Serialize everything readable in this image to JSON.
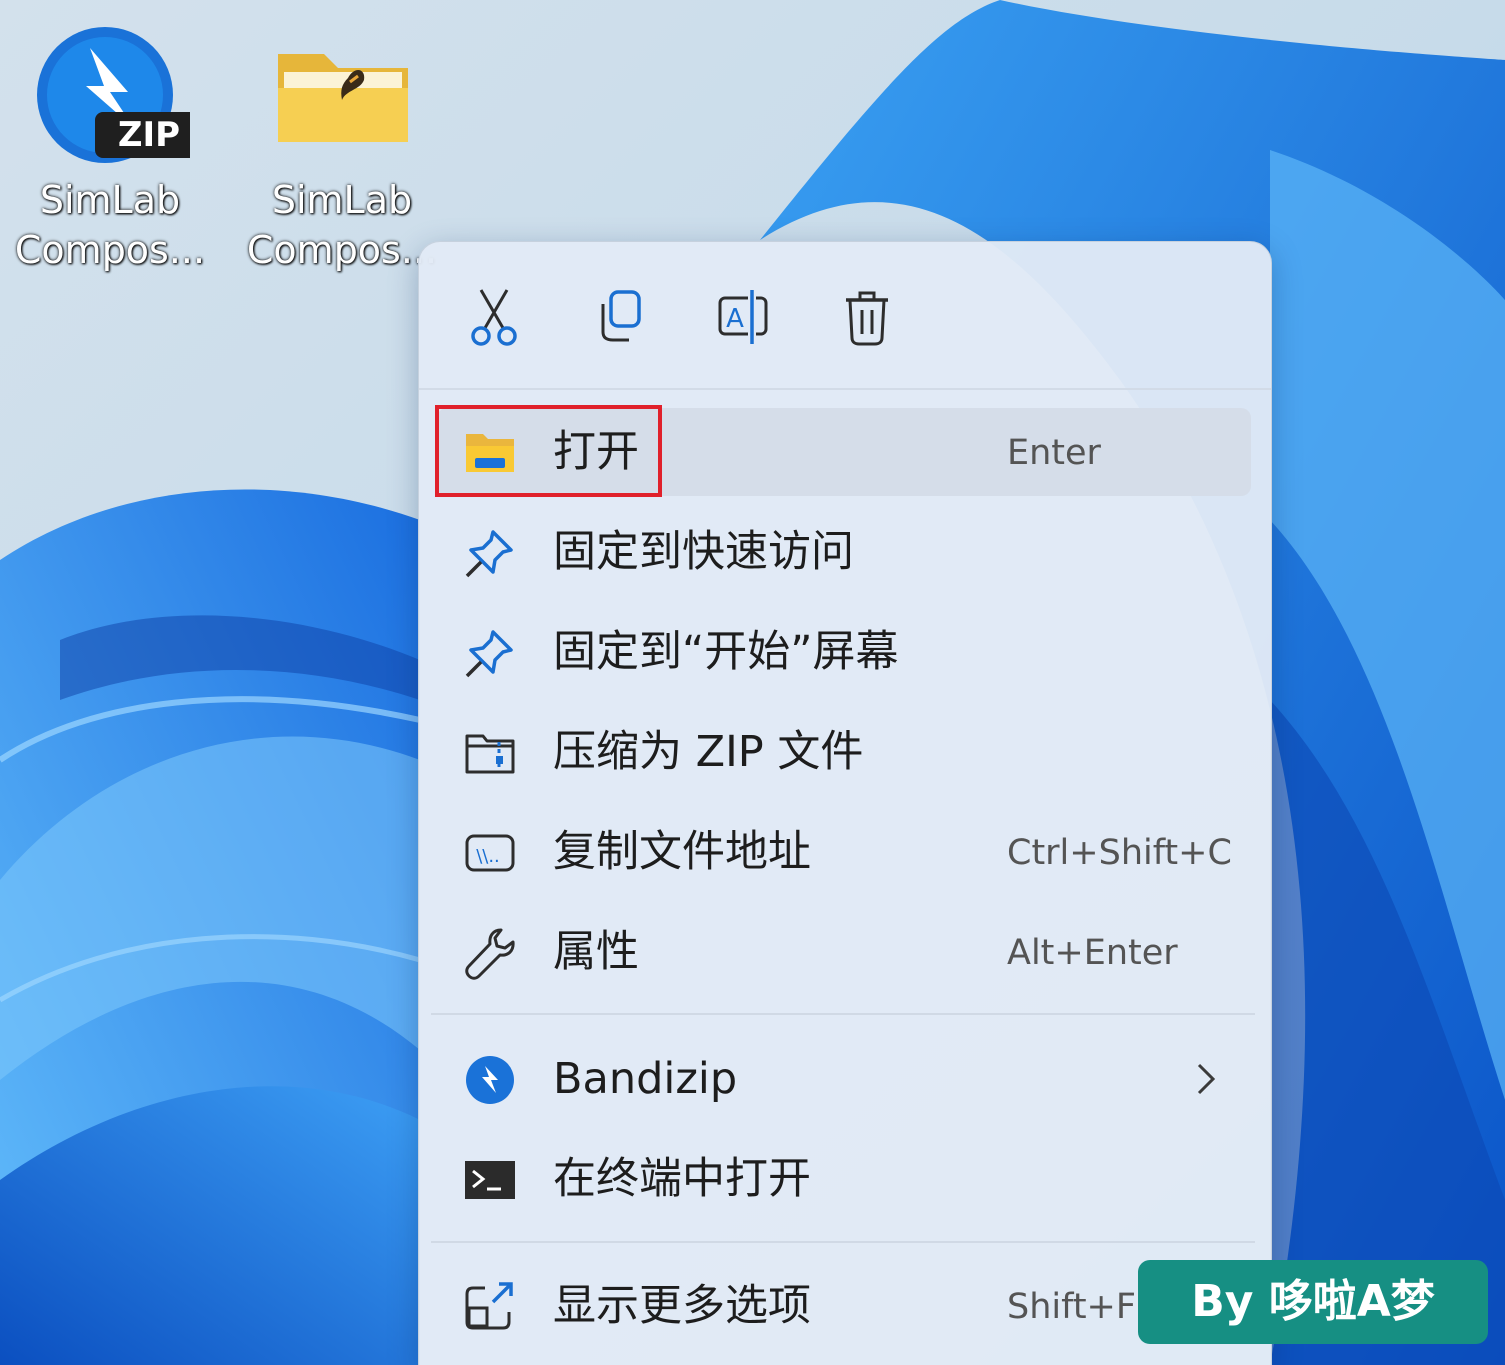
{
  "desktop": {
    "icons": [
      {
        "label_line1": "SimLab",
        "label_line2": "Compos...",
        "badge": "ZIP",
        "icon": "bandizip-zip-icon"
      },
      {
        "label_line1": "SimLab",
        "label_line2": "Compos...",
        "icon": "folder-icon"
      }
    ]
  },
  "context_menu": {
    "toolbar": [
      {
        "name": "cut",
        "icon": "scissors-icon"
      },
      {
        "name": "copy",
        "icon": "copy-icon"
      },
      {
        "name": "rename",
        "icon": "rename-icon",
        "glyph": "A"
      },
      {
        "name": "delete",
        "icon": "trash-icon"
      }
    ],
    "items": [
      {
        "label": "打开",
        "shortcut": "Enter",
        "icon": "open-folder-icon"
      },
      {
        "label": "固定到快速访问",
        "shortcut": "",
        "icon": "pin-icon"
      },
      {
        "label": "固定到“开始”屏幕",
        "shortcut": "",
        "icon": "pin-icon"
      },
      {
        "label": "压缩为 ZIP 文件",
        "shortcut": "",
        "icon": "zip-folder-icon"
      },
      {
        "label": "复制文件地址",
        "shortcut": "Ctrl+Shift+C",
        "icon": "copy-path-icon",
        "glyph": "\\\\.."
      },
      {
        "label": "属性",
        "shortcut": "Alt+Enter",
        "icon": "wrench-icon"
      },
      {
        "label": "Bandizip",
        "shortcut": "",
        "icon": "bandizip-icon",
        "has_submenu": true
      },
      {
        "label": "在终端中打开",
        "shortcut": "",
        "icon": "terminal-icon"
      },
      {
        "label": "显示更多选项",
        "shortcut": "Shift+F",
        "icon": "more-options-icon"
      }
    ],
    "highlighted_item": "打开"
  },
  "watermark": {
    "text": "By 哆啦A梦"
  },
  "colors": {
    "accent": "#1a6fd1",
    "highlight_border": "#e0202b",
    "watermark_bg": "#168f83",
    "menu_bg": "#e2eaf6"
  }
}
